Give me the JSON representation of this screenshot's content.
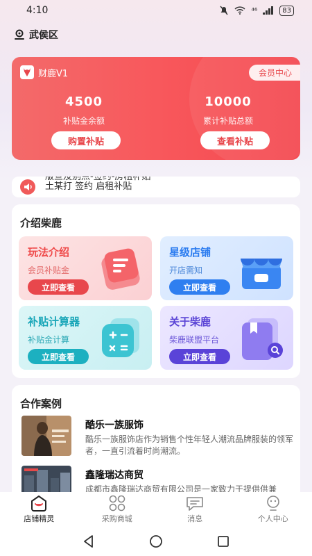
{
  "status_bar": {
    "time": "4:10",
    "signal": "⁴⁶",
    "battery": "83"
  },
  "location": {
    "name": "武侯区"
  },
  "member_card": {
    "brand": "财鹿V1",
    "vip_center": "会员中心",
    "subsidy_balance_value": "4500",
    "subsidy_balance_label": "补贴金余额",
    "subsidy_total_value": "10000",
    "subsidy_total_label": "累计补贴总额",
    "buy_button": "购置补贴",
    "view_button": "查看补贴"
  },
  "notice": {
    "line1": "版旦及别点-签约-房租补贴",
    "line2": "土某打 签约 启租补贴"
  },
  "intro": {
    "title": "介绍柴鹿",
    "cards": [
      {
        "title": "玩法介绍",
        "subtitle": "会员补贴金",
        "button": "立即查看"
      },
      {
        "title": "星级店铺",
        "subtitle": "开店需知",
        "button": "立即查看"
      },
      {
        "title": "补贴计算器",
        "subtitle": "补贴金计算",
        "button": "立即查看"
      },
      {
        "title": "关于柴鹿",
        "subtitle": "柴鹿联盟平台",
        "button": "立即查看"
      }
    ]
  },
  "cases": {
    "title": "合作案例",
    "items": [
      {
        "name": "酷乐一族服饰",
        "desc": "酷乐一族服饰店作为销售个性年轻人潮流品牌服装的领军者，一直引流着时尚潮流。"
      },
      {
        "name": "鑫隆瑞达商贸",
        "desc": "成都市鑫隆瑞达商贸有限公司是一家致力于提供供兼"
      }
    ]
  },
  "tabbar": {
    "items": [
      {
        "label": "店铺精灵",
        "icon": "shop-icon",
        "active": true
      },
      {
        "label": "采购商城",
        "icon": "grid-icon",
        "active": false
      },
      {
        "label": "消息",
        "icon": "message-icon",
        "active": false
      },
      {
        "label": "个人中心",
        "icon": "person-icon",
        "active": false
      }
    ]
  },
  "colors": {
    "accent": "#e8474c",
    "blue": "#2f7ff0",
    "teal": "#1cb0c0",
    "purple": "#5a43d8"
  }
}
